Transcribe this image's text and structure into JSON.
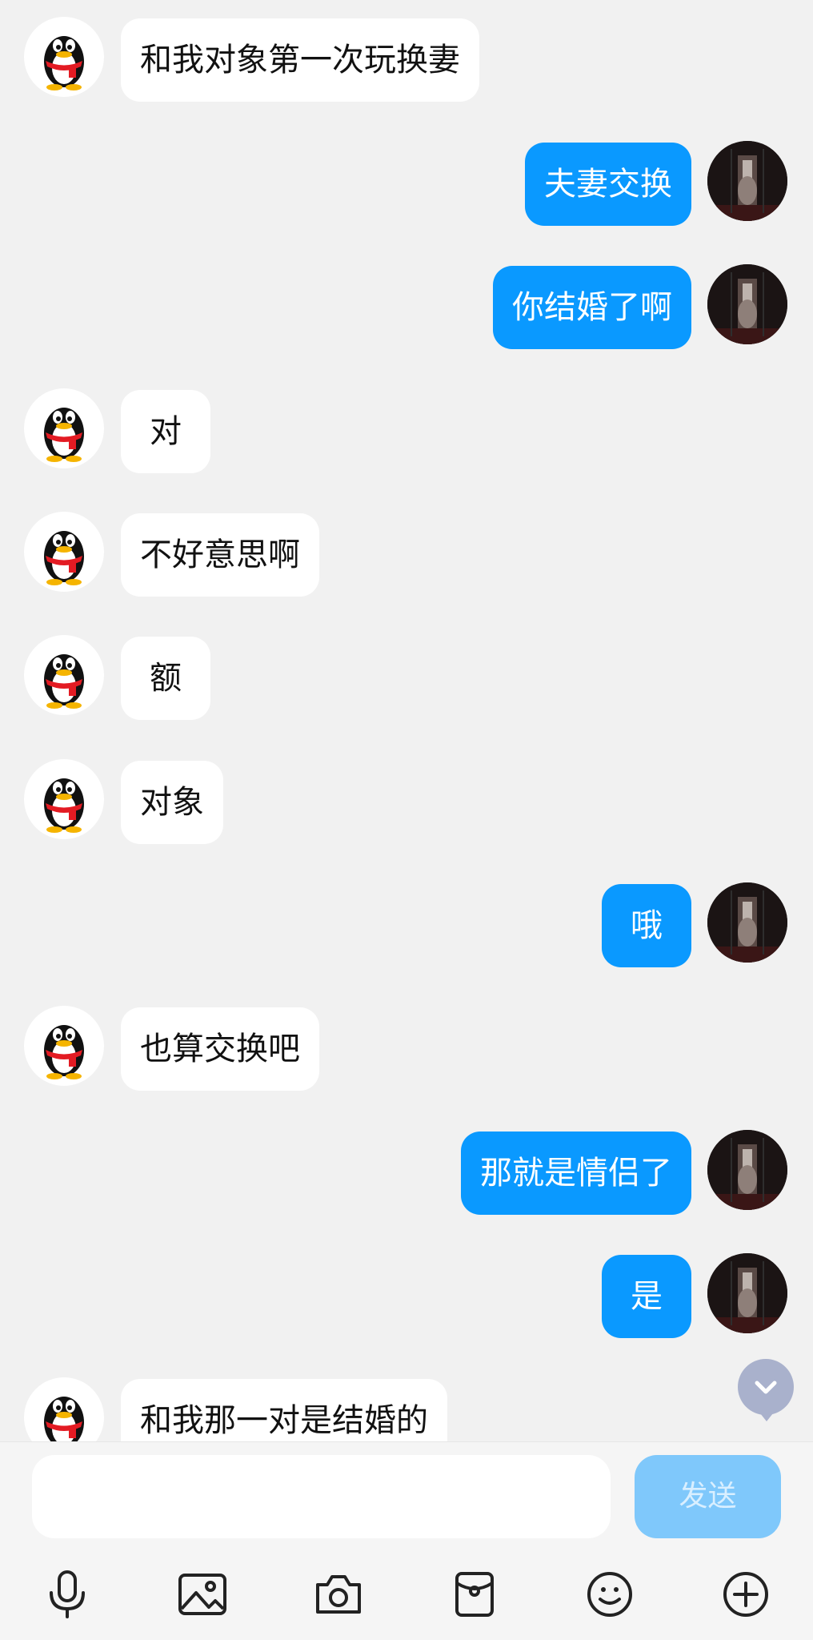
{
  "messages": [
    {
      "side": "peer",
      "text": "和我对象第一次玩换妻"
    },
    {
      "side": "me",
      "text": "夫妻交换"
    },
    {
      "side": "me",
      "text": "你结婚了啊"
    },
    {
      "side": "peer",
      "text": "对"
    },
    {
      "side": "peer",
      "text": "不好意思啊"
    },
    {
      "side": "peer",
      "text": "额"
    },
    {
      "side": "peer",
      "text": "对象"
    },
    {
      "side": "me",
      "text": "哦"
    },
    {
      "side": "peer",
      "text": "也算交换吧"
    },
    {
      "side": "me",
      "text": "那就是情侣了"
    },
    {
      "side": "me",
      "text": "是"
    },
    {
      "side": "peer",
      "text": "和我那一对是结婚的"
    }
  ],
  "composer": {
    "input_value": "",
    "send_label": "发送"
  },
  "toolbar": {
    "icons": [
      "microphone-icon",
      "image-icon",
      "camera-icon",
      "red-packet-icon",
      "emoji-icon",
      "plus-icon"
    ]
  },
  "colors": {
    "background": "#f1f1f1",
    "my_bubble": "#0a99ff",
    "peer_bubble": "#ffffff",
    "send_disabled": "#7fc8fb"
  }
}
